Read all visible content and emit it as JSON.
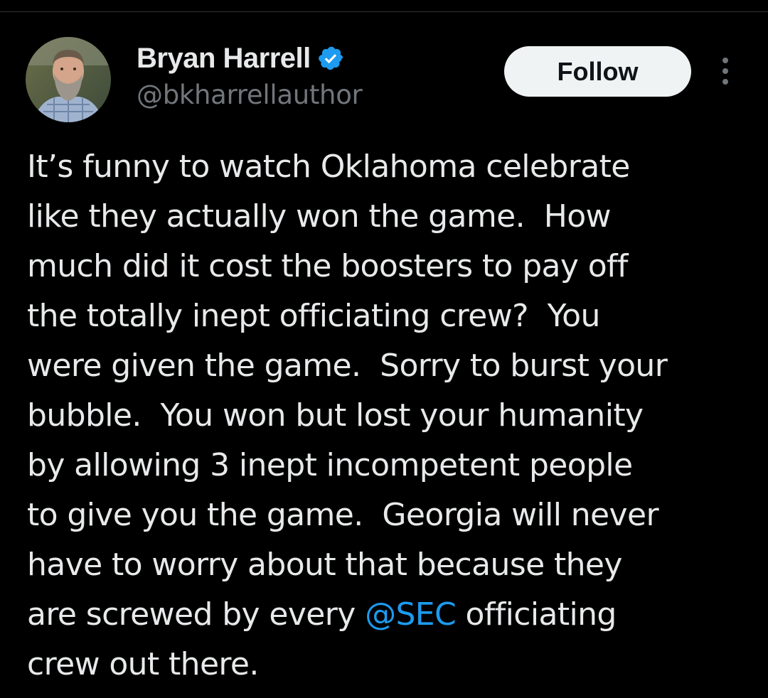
{
  "colors": {
    "background": "#000000",
    "text_primary": "#e7e9ea",
    "text_secondary": "#71767b",
    "link": "#1d9bf0",
    "verified_badge": "#1d9bf0",
    "follow_button_bg": "#eff3f4",
    "follow_button_text": "#0f1419"
  },
  "author": {
    "display_name": "Bryan Harrell",
    "handle": "@bkharrellauthor",
    "verified_icon": "verified-badge-icon",
    "avatar_icon": "profile-photo"
  },
  "actions": {
    "follow_label": "Follow",
    "more_icon": "more-vertical-icon"
  },
  "tweet": {
    "lines": [
      "It’s funny to watch Oklahoma celebrate",
      "like they actually won the game.  How",
      "much did it cost the boosters to pay off",
      "the totally inept officiating crew?  You",
      "were given the game.  Sorry to burst your",
      "bubble.  You won but lost your humanity",
      "by allowing 3 inept incompetent people",
      "to give you the game.  Georgia will never",
      "have to worry about that because they"
    ],
    "line10_before": "are screwed by every ",
    "mention": "@SEC",
    "line10_after": " officiating",
    "line11": "crew out there."
  }
}
